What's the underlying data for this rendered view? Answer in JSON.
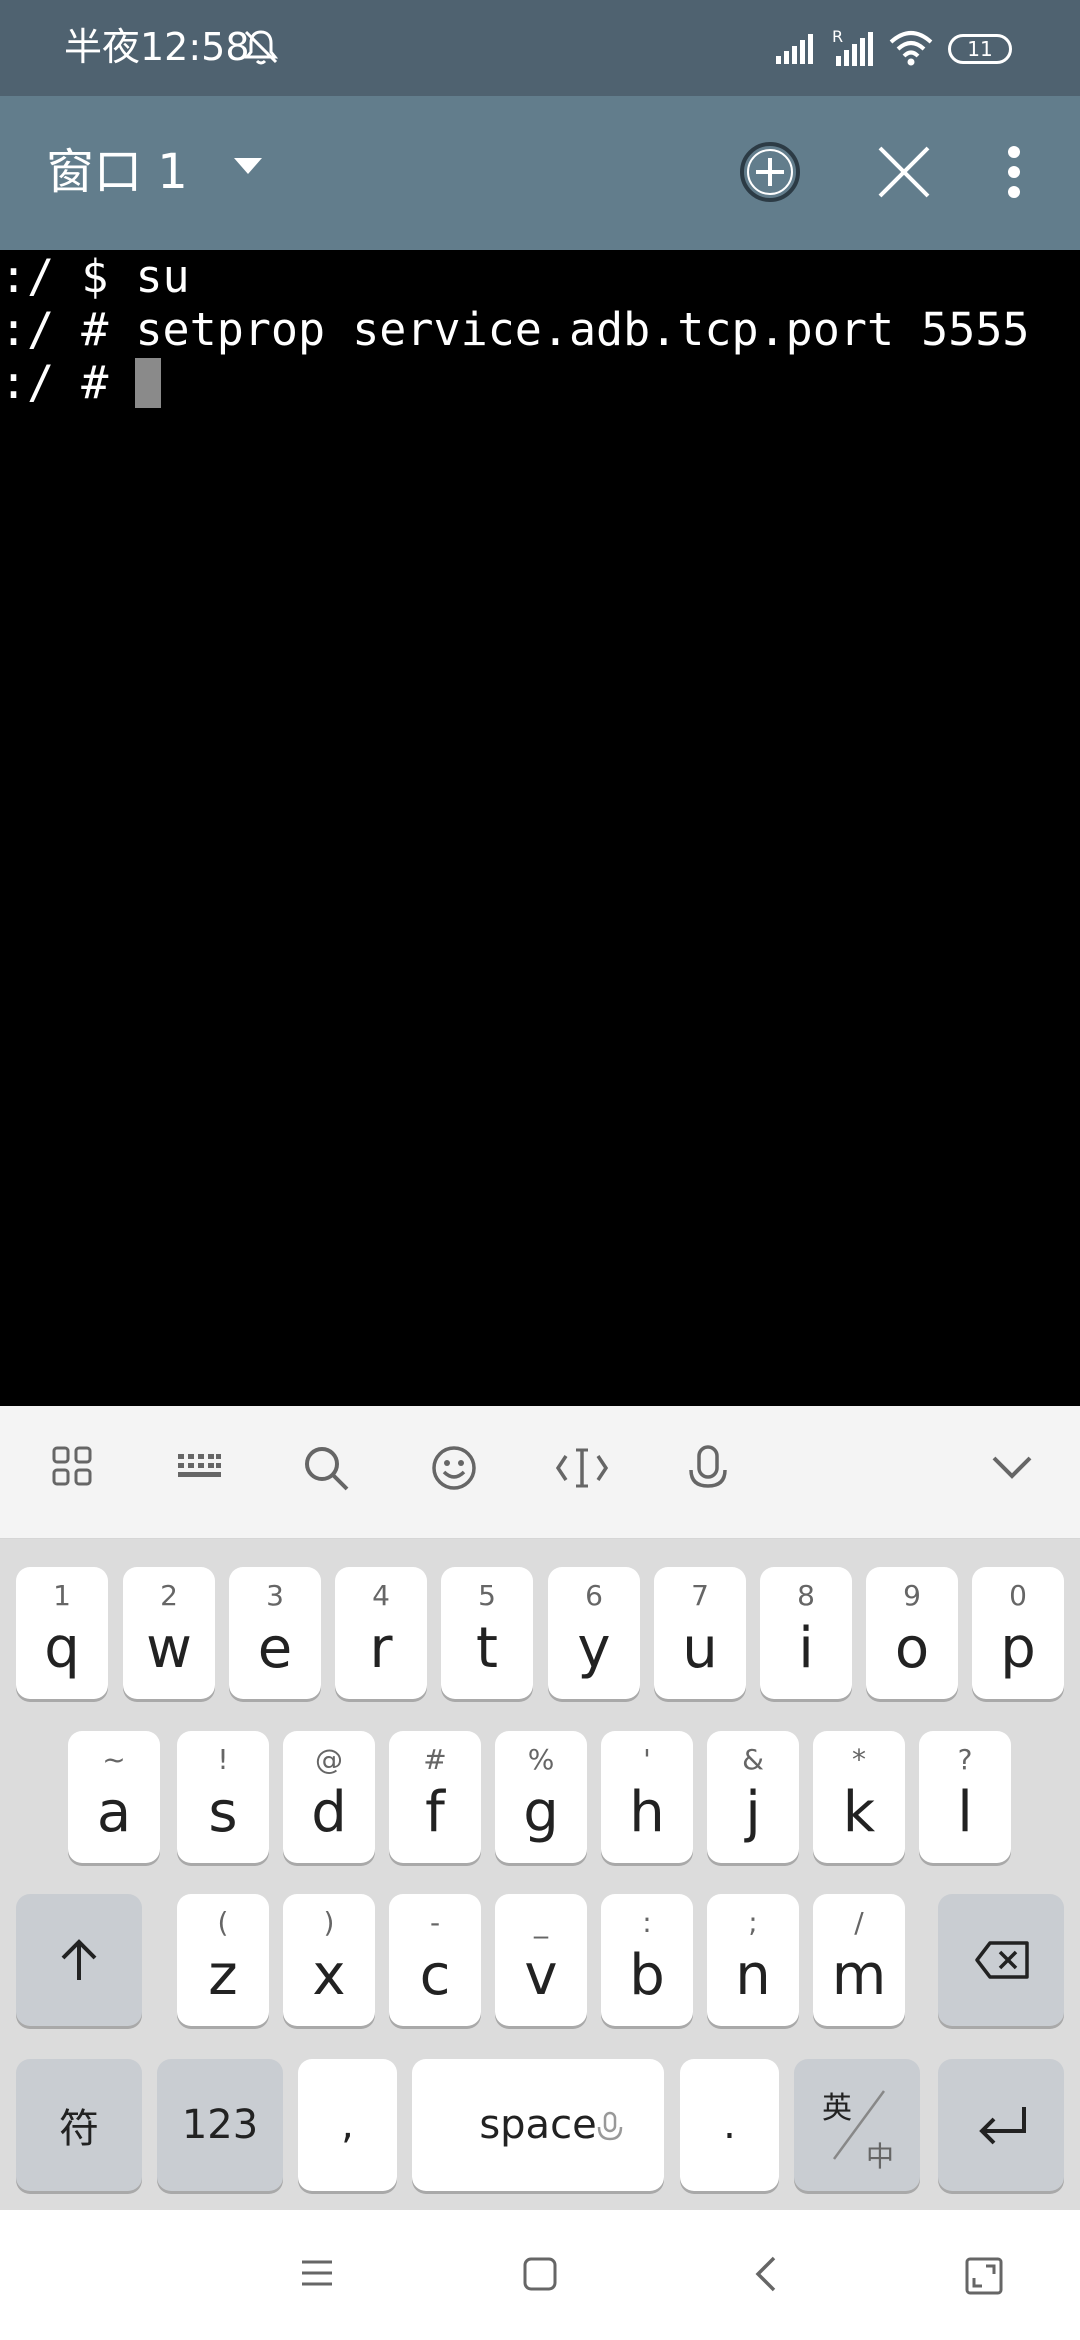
{
  "status_bar": {
    "time": "半夜12:58",
    "battery": "11",
    "icons": [
      "mute-icon",
      "cell-signal-icon",
      "roaming-signal-icon",
      "wifi-icon",
      "battery-icon"
    ]
  },
  "app_bar": {
    "title": "窗口 1",
    "icons": [
      "dropdown-icon",
      "add-circle-icon",
      "close-icon",
      "more-vert-icon"
    ]
  },
  "terminal": {
    "lines": [
      ":/ $ su",
      ":/ # setprop service.adb.tcp.port 5555",
      ":/ # "
    ]
  },
  "keyboard_toolbar": {
    "icons": [
      "apps-grid-icon",
      "keyboard-icon",
      "search-icon",
      "emoji-icon",
      "cursor-icon",
      "mic-icon",
      "collapse-icon"
    ]
  },
  "keyboard": {
    "row1": [
      {
        "hint": "1",
        "key": "q"
      },
      {
        "hint": "2",
        "key": "w"
      },
      {
        "hint": "3",
        "key": "e"
      },
      {
        "hint": "4",
        "key": "r"
      },
      {
        "hint": "5",
        "key": "t"
      },
      {
        "hint": "6",
        "key": "y"
      },
      {
        "hint": "7",
        "key": "u"
      },
      {
        "hint": "8",
        "key": "i"
      },
      {
        "hint": "9",
        "key": "o"
      },
      {
        "hint": "0",
        "key": "p"
      }
    ],
    "row2": [
      {
        "hint": "~",
        "key": "a"
      },
      {
        "hint": "!",
        "key": "s"
      },
      {
        "hint": "@",
        "key": "d"
      },
      {
        "hint": "#",
        "key": "f"
      },
      {
        "hint": "%",
        "key": "g"
      },
      {
        "hint": "'",
        "key": "h"
      },
      {
        "hint": "&",
        "key": "j"
      },
      {
        "hint": "*",
        "key": "k"
      },
      {
        "hint": "?",
        "key": "l"
      }
    ],
    "row3": [
      {
        "hint": "(",
        "key": "z"
      },
      {
        "hint": ")",
        "key": "x"
      },
      {
        "hint": "-",
        "key": "c"
      },
      {
        "hint": "_",
        "key": "v"
      },
      {
        "hint": ":",
        "key": "b"
      },
      {
        "hint": ";",
        "key": "n"
      },
      {
        "hint": "/",
        "key": "m"
      }
    ],
    "symbols_key": "符",
    "numbers_key": "123",
    "comma_key": ",",
    "space_key": "space",
    "period_key": ".",
    "lang_key_top": "英",
    "lang_key_bottom": "中"
  },
  "nav_bar": {
    "icons": [
      "menu-icon",
      "home-icon",
      "back-icon",
      "rotate-icon"
    ]
  }
}
